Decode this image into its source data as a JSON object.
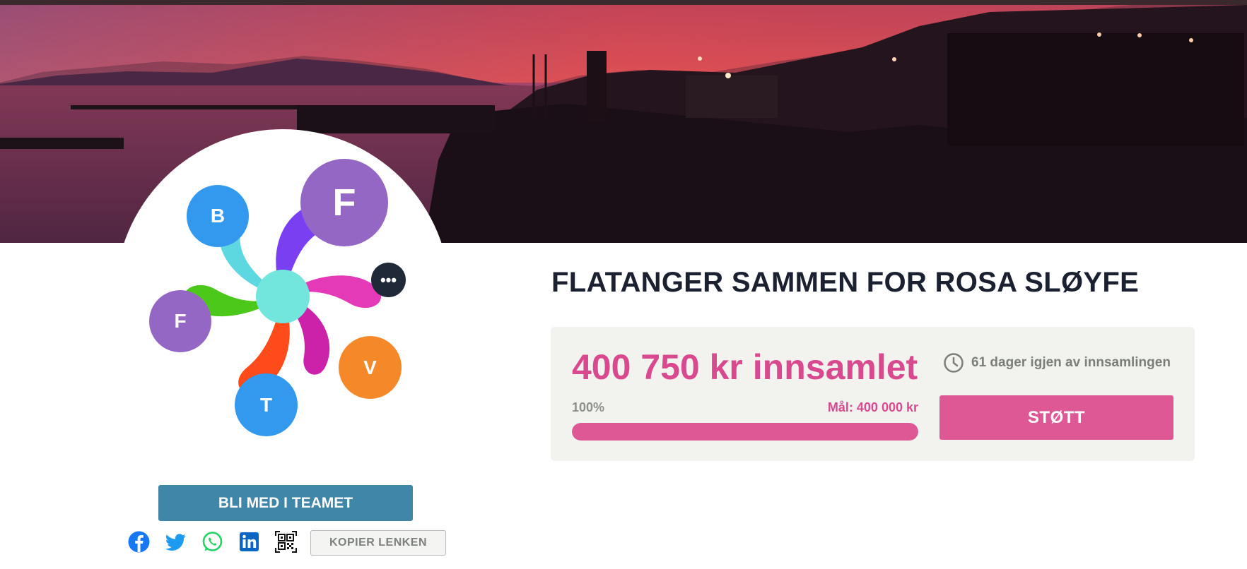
{
  "campaign": {
    "title": "FLATANGER SAMMEN FOR ROSA SLØYFE",
    "raised": "400 750 kr innsamlet",
    "days_left": "61 dager igjen av innsamlingen",
    "percent_label": "100%",
    "progress_fraction": 1.0,
    "goal": "Mål: 400 000 kr",
    "support_label": "STØTT"
  },
  "team": {
    "members": [
      {
        "initial": "F",
        "color": "#9467c4"
      },
      {
        "initial": "B",
        "color": "#3399ee"
      },
      {
        "initial": "F",
        "color": "#9467c4"
      },
      {
        "initial": "V",
        "color": "#f5892a"
      },
      {
        "initial": "T",
        "color": "#3399ee"
      }
    ],
    "more_label": "•••",
    "join_label": "BLI MED I TEAMET"
  },
  "share": {
    "icons": [
      "facebook-icon",
      "twitter-icon",
      "whatsapp-icon",
      "linkedin-icon",
      "qr-code-icon"
    ],
    "copy_label": "KOPIER LENKEN"
  },
  "colors": {
    "accent_pink": "#de5895",
    "team_blue": "#3f86a8",
    "title_dark": "#1b2130"
  }
}
